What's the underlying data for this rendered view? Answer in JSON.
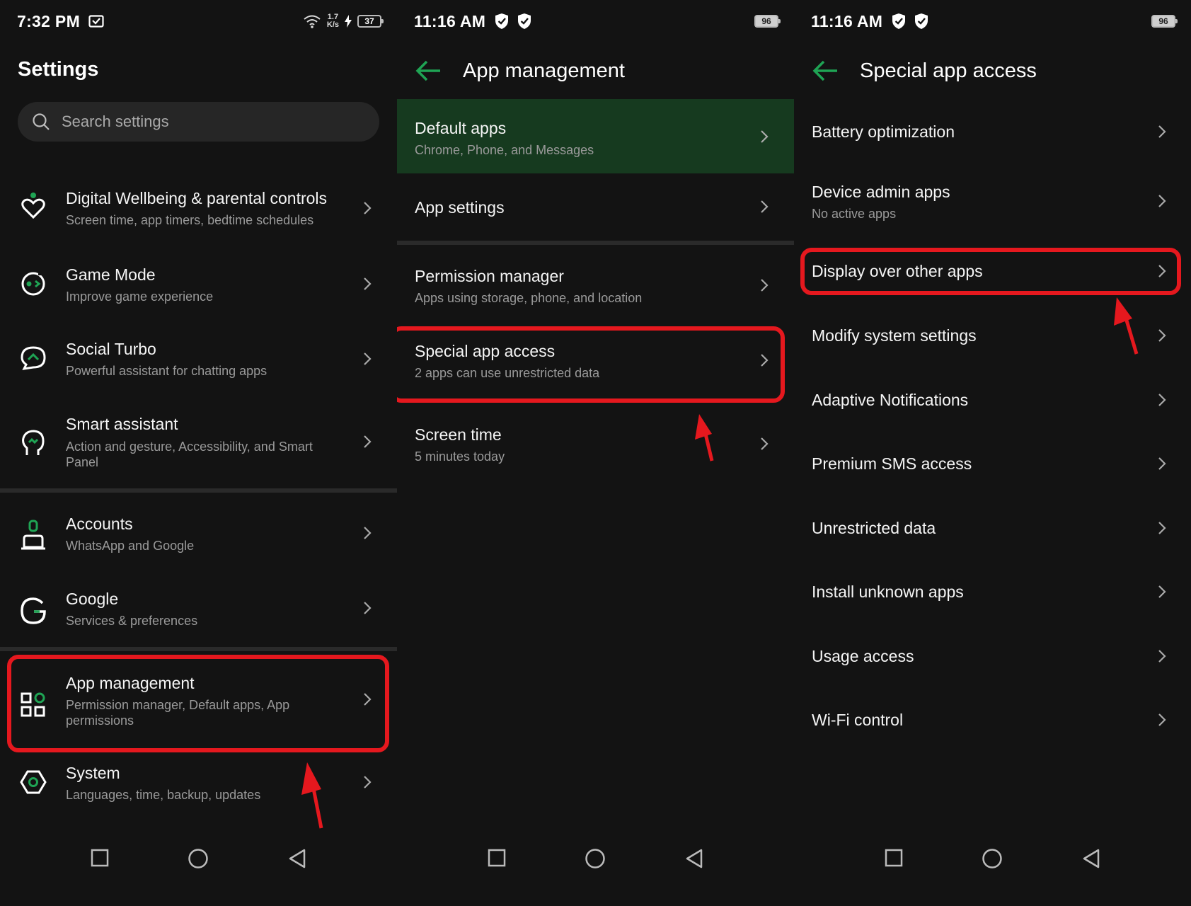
{
  "colors": {
    "accent": "#1fa454",
    "highlight": "#e5181e",
    "background": "#131313",
    "selected_row": "#163a1f"
  },
  "panel1": {
    "status": {
      "time": "7:32 PM",
      "net_speed_value": "1.7",
      "net_speed_unit": "K/s",
      "battery": "37"
    },
    "title": "Settings",
    "search": {
      "placeholder": "Search settings",
      "icon": "search-icon"
    },
    "items": [
      {
        "title": "Digital Wellbeing & parental controls",
        "subtitle": "Screen time, app timers, bedtime schedules",
        "icon": "wellbeing-heart-icon"
      },
      {
        "title": "Game Mode",
        "subtitle": "Improve game experience",
        "icon": "game-controller-icon"
      },
      {
        "title": "Social Turbo",
        "subtitle": "Powerful assistant for chatting apps",
        "icon": "chat-bubble-icon"
      },
      {
        "title": "Smart assistant",
        "subtitle": "Action and gesture, Accessibility, and Smart Panel",
        "icon": "head-gesture-icon"
      },
      {
        "title": "Accounts",
        "subtitle": "WhatsApp and Google",
        "icon": "account-person-icon"
      },
      {
        "title": "Google",
        "subtitle": "Services & preferences",
        "icon": "google-g-icon"
      },
      {
        "title": "App management",
        "subtitle": "Permission manager, Default apps, App permissions",
        "icon": "apps-grid-icon"
      },
      {
        "title": "System",
        "subtitle": "Languages, time, backup, updates",
        "icon": "system-gear-icon"
      }
    ]
  },
  "panel2": {
    "status": {
      "time": "11:16 AM",
      "battery": "96"
    },
    "title": "App management",
    "items": [
      {
        "title": "Default apps",
        "subtitle": "Chrome, Phone, and Messages"
      },
      {
        "title": "App settings"
      },
      {
        "title": "Permission manager",
        "subtitle": "Apps using storage, phone, and location"
      },
      {
        "title": "Special app access",
        "subtitle": "2 apps can use unrestricted data"
      },
      {
        "title": "Screen time",
        "subtitle": "5 minutes today"
      }
    ]
  },
  "panel3": {
    "status": {
      "time": "11:16 AM",
      "battery": "96"
    },
    "title": "Special app access",
    "items": [
      {
        "title": "Battery optimization"
      },
      {
        "title": "Device admin apps",
        "subtitle": "No active apps"
      },
      {
        "title": "Display over other apps"
      },
      {
        "title": "Modify system settings"
      },
      {
        "title": "Adaptive Notifications"
      },
      {
        "title": "Premium SMS access"
      },
      {
        "title": "Unrestricted data"
      },
      {
        "title": "Install unknown apps"
      },
      {
        "title": "Usage access"
      },
      {
        "title": "Wi-Fi control"
      }
    ]
  },
  "navbar": {
    "buttons": [
      "recents-square-icon",
      "home-circle-icon",
      "back-triangle-icon"
    ]
  }
}
